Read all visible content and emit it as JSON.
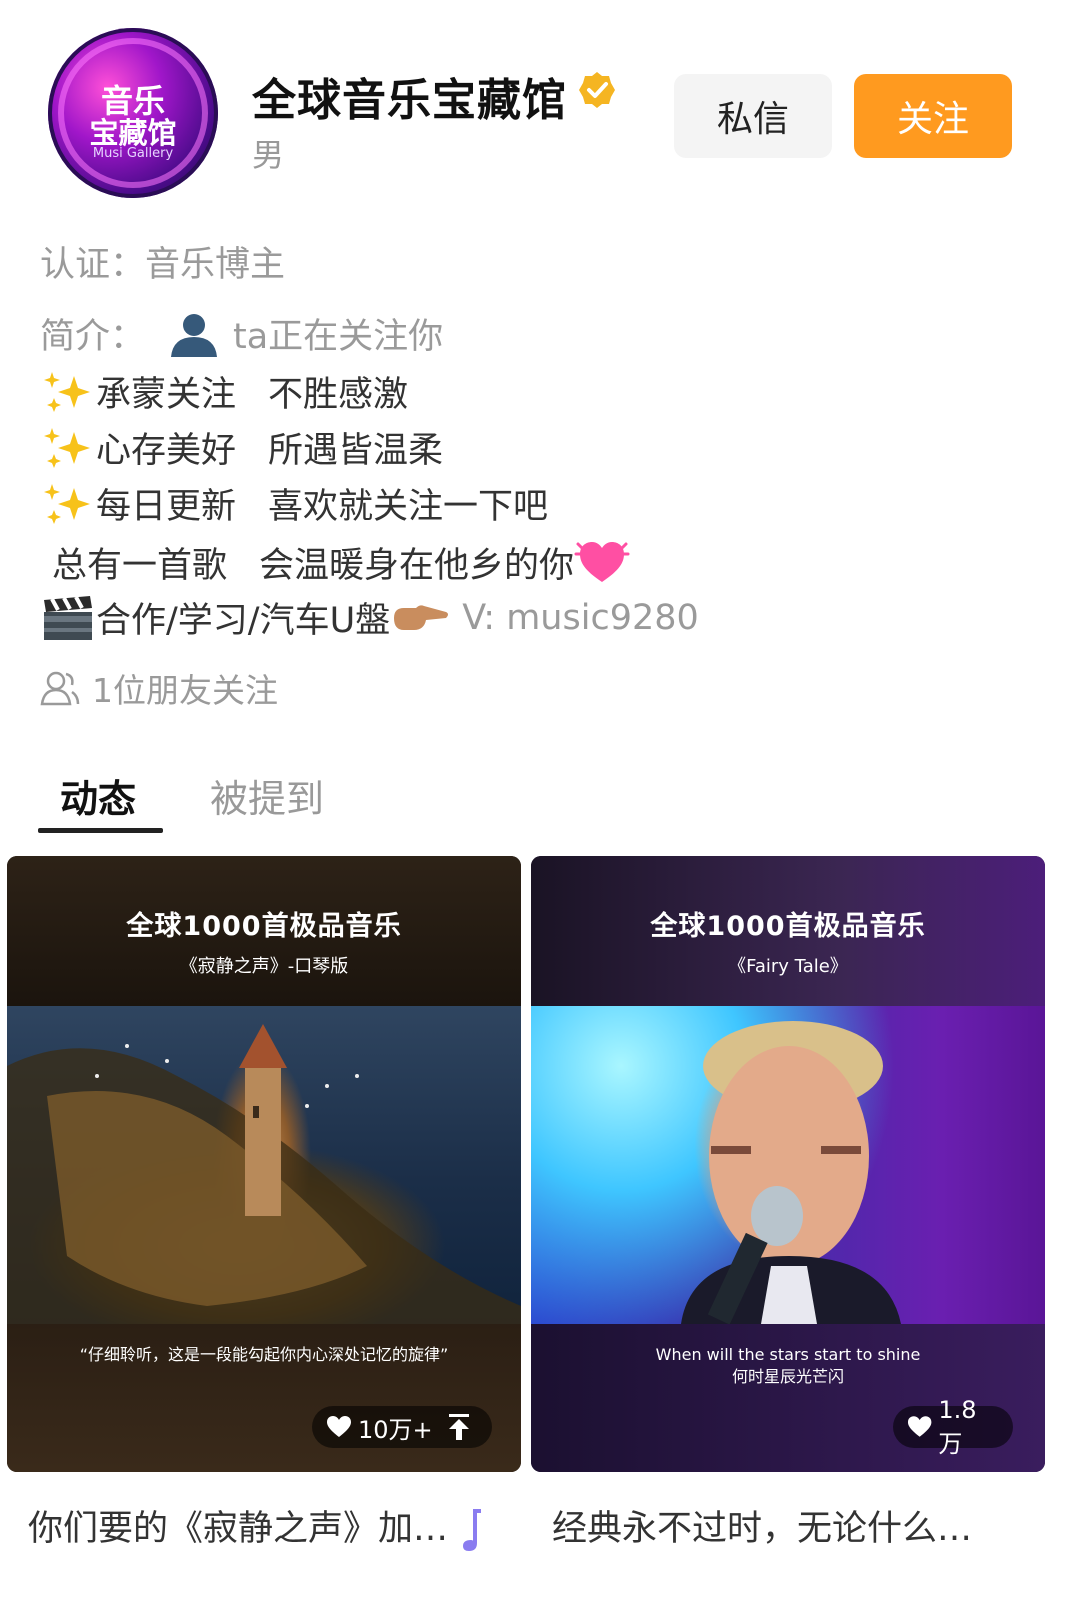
{
  "profile": {
    "avatar_text_1": "音乐",
    "avatar_text_2": "宝藏馆",
    "avatar_text_3": "Musi Gallery",
    "name": "全球音乐宝藏馆",
    "gender": "男",
    "verified_icon": "verified-badge-icon",
    "message_button": "私信",
    "follow_button": "关注",
    "follow_color": "#ff9a1f"
  },
  "bio": {
    "cert_label": "认证：",
    "cert_value": "音乐博主",
    "intro_label": "简介：",
    "intro_line": "ta正在关注你",
    "line3_a": "承蒙关注",
    "line3_b": "不胜感激",
    "line4_a": "心存美好",
    "line4_b": "所遇皆温柔",
    "line5_a": "每日更新",
    "line5_b": "喜欢就关注一下吧",
    "line6_a": "总有一首歌",
    "line6_b": "会温暖身在他乡的你",
    "line7_a": "合作/学习/汽车U盤",
    "line7_b": "V: music9280",
    "friends": "1位朋友关注"
  },
  "tabs": [
    {
      "label": "动态",
      "active": true
    },
    {
      "label": "被提到",
      "active": false
    }
  ],
  "posts": [
    {
      "head": "全球1000首极品音乐",
      "sub": "《寂静之声》-口琴版",
      "caption": "“仔细聆听，这是一段能勾起你内心深处记忆的旋律”",
      "likes": "10万+",
      "pinned": true,
      "title": "你们要的《寂静之声》加…"
    },
    {
      "head": "全球1000首极品音乐",
      "sub": "《Fairy Tale》",
      "caption_1": "When will the stars start to shine",
      "caption_2": "何时星辰光芒闪",
      "likes": "1.8万",
      "pinned": false,
      "title": "经典永不过时，无论什么…"
    }
  ]
}
